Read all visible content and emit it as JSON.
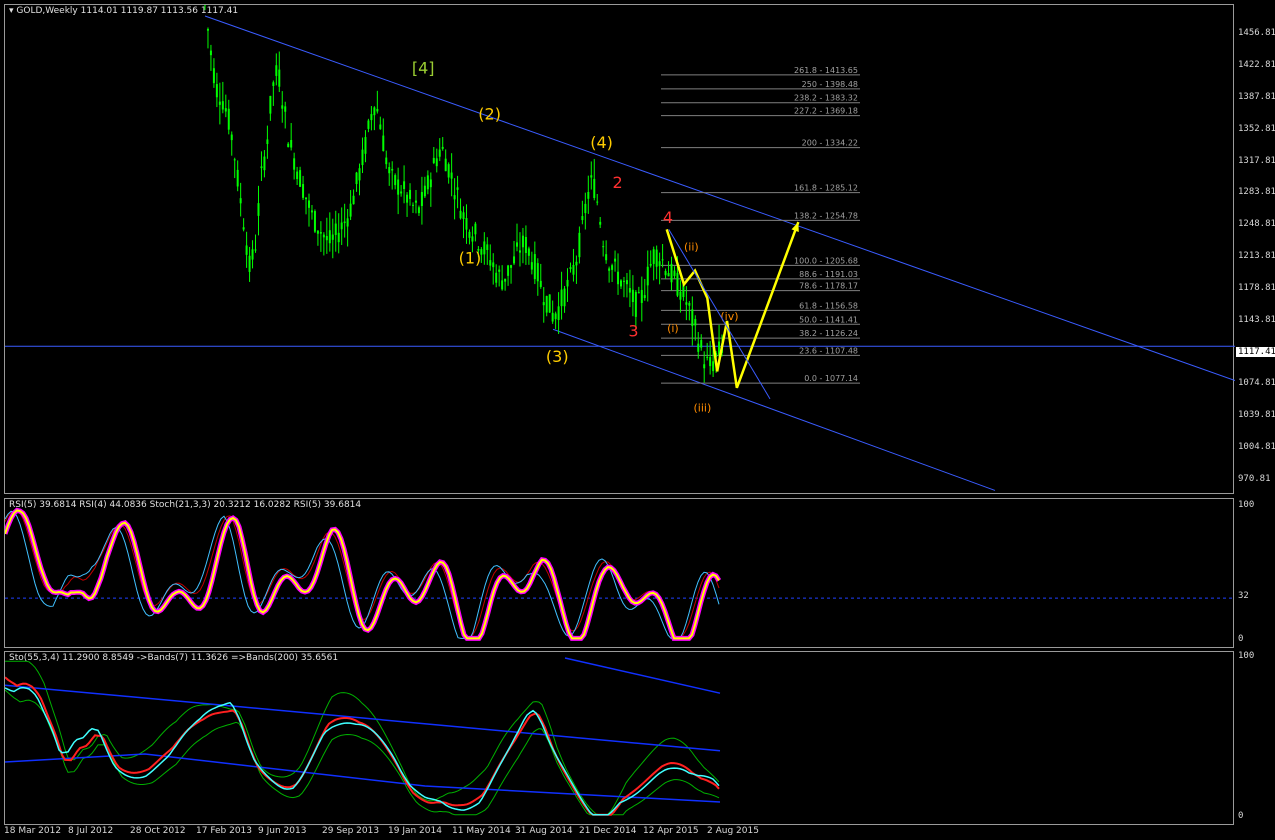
{
  "main_title": "GOLD,Weekly",
  "main_ohlc": "1114.01 1119.87 1113.56 1117.41",
  "rsi_title": "RSI(5) 39.6814  RSI(4) 44.0836  Stoch(21,3,3) 20.3212 16.0282  RSI(5) 39.6814",
  "sto_title": "Sto(55,3,4) 11.2900 8.8549  ->Bands(7) 11.3626  =>Bands(200) 35.6561",
  "current_price": "1117.41",
  "colors": {
    "candle": "#00ff00",
    "channel": "#3a5cff",
    "arrow": "#ffff00",
    "fib": "#808080",
    "wave_label": "#ffcc00",
    "wave_small": "#ff3030",
    "minor_wave": "#ff8c00",
    "rsi_main": "#ffff00",
    "rsi_glow": "#ff00ff"
  },
  "chart_data": [
    {
      "type": "candlestick",
      "title": "GOLD,Weekly",
      "ylim": [
        955,
        1490
      ],
      "yticks": [
        "1456.81",
        "1422.81",
        "1387.81",
        "1352.81",
        "1317.81",
        "1283.81",
        "1248.81",
        "1213.81",
        "1178.81",
        "1143.81",
        "1108.81",
        "1074.81",
        "1039.81",
        "1004.81",
        "970.81"
      ],
      "ytick_values": [
        1456.81,
        1422.81,
        1387.81,
        1352.81,
        1317.81,
        1283.81,
        1248.81,
        1213.81,
        1178.81,
        1143.81,
        1108.81,
        1074.81,
        1039.81,
        1004.81,
        970.81
      ],
      "x_labels": [
        "18 Mar 2012",
        "8 Jul 2012",
        "28 Oct 2012",
        "17 Feb 2013",
        "9 Jun 2013",
        "29 Sep 2013",
        "19 Jan 2014",
        "11 May 2014",
        "31 Aug 2014",
        "21 Dec 2014",
        "12 Apr 2015",
        "2 Aug 2015"
      ],
      "price_path": [
        1490,
        1440,
        1400,
        1390,
        1370,
        1340,
        1290,
        1250,
        1200,
        1230,
        1300,
        1340,
        1400,
        1420,
        1380,
        1340,
        1320,
        1300,
        1280,
        1260,
        1250,
        1240,
        1230,
        1235,
        1245,
        1255,
        1270,
        1295,
        1320,
        1350,
        1385,
        1370,
        1330,
        1300,
        1295,
        1290,
        1280,
        1270,
        1265,
        1280,
        1300,
        1320,
        1335,
        1320,
        1300,
        1280,
        1260,
        1250,
        1240,
        1230,
        1220,
        1210,
        1195,
        1190,
        1200,
        1210,
        1225,
        1230,
        1215,
        1200,
        1180,
        1165,
        1150,
        1160,
        1175,
        1190,
        1210,
        1240,
        1280,
        1300,
        1270,
        1230,
        1210,
        1200,
        1190,
        1180,
        1170,
        1160,
        1175,
        1200,
        1220,
        1215,
        1205,
        1195,
        1185,
        1175,
        1160,
        1140,
        1120,
        1100,
        1095,
        1105,
        1117
      ],
      "fib_levels": [
        {
          "label": "261.8 - 1413.65",
          "value": 1413.65
        },
        {
          "label": "250 - 1398.48",
          "value": 1398.48
        },
        {
          "label": "238.2 - 1383.32",
          "value": 1383.32
        },
        {
          "label": "227.2 - 1369.18",
          "value": 1369.18
        },
        {
          "label": "200 - 1334.22",
          "value": 1334.22
        },
        {
          "label": "161.8 - 1285.12",
          "value": 1285.12
        },
        {
          "label": "138.2 - 1254.78",
          "value": 1254.78
        },
        {
          "label": "100.0 - 1205.68",
          "value": 1205.68
        },
        {
          "label": "88.6 - 1191.03",
          "value": 1191.03
        },
        {
          "label": "78.6 - 1178.17",
          "value": 1178.17
        },
        {
          "label": "61.8 - 1156.58",
          "value": 1156.58
        },
        {
          "label": "50.0 - 1141.41",
          "value": 1141.41
        },
        {
          "label": "38.2 - 1126.24",
          "value": 1126.24
        },
        {
          "label": "23.6 - 1107.48",
          "value": 1107.48
        },
        {
          "label": "0.0 - 1077.14",
          "value": 1077.14
        }
      ],
      "wave_labels": [
        {
          "text": "[4]",
          "color": "#9acd32",
          "x_frac": 0.34,
          "value": 1415
        },
        {
          "text": "(2)",
          "color": "#ffcc00",
          "x_frac": 0.394,
          "value": 1365
        },
        {
          "text": "(4)",
          "color": "#ffcc00",
          "x_frac": 0.485,
          "value": 1334
        },
        {
          "text": "(1)",
          "color": "#ffcc00",
          "x_frac": 0.378,
          "value": 1208
        },
        {
          "text": "(3)",
          "color": "#ffcc00",
          "x_frac": 0.449,
          "value": 1100
        },
        {
          "text": "2",
          "color": "#ff3030",
          "x_frac": 0.498,
          "value": 1290
        },
        {
          "text": "4",
          "color": "#ff3030",
          "x_frac": 0.539,
          "value": 1252
        },
        {
          "text": "3",
          "color": "#ff3030",
          "x_frac": 0.511,
          "value": 1128
        },
        {
          "text": "(ii)",
          "color": "#ff8c00",
          "x_frac": 0.558,
          "value": 1222
        },
        {
          "text": "(i)",
          "color": "#ff8c00",
          "x_frac": 0.543,
          "value": 1133
        },
        {
          "text": "(iv)",
          "color": "#ff8c00",
          "x_frac": 0.589,
          "value": 1146
        },
        {
          "text": "(iii)",
          "color": "#ff8c00",
          "x_frac": 0.567,
          "value": 1046
        }
      ],
      "projection_arrow": [
        [
          0.538,
          1245
        ],
        [
          0.552,
          1185
        ],
        [
          0.561,
          1200
        ],
        [
          0.571,
          1170
        ],
        [
          0.579,
          1090
        ],
        [
          0.587,
          1145
        ],
        [
          0.595,
          1072
        ],
        [
          0.645,
          1253
        ]
      ]
    },
    {
      "type": "line",
      "title": "RSI(5) 39.6814  RSI(4) 44.0836  Stoch(21,3,3) 20.3212 16.0282  RSI(5) 39.6814",
      "ylim": [
        0,
        100
      ],
      "yticks": [
        "100",
        "32",
        "0"
      ],
      "ytick_values": [
        100,
        32,
        0
      ],
      "level_line": 32
    },
    {
      "type": "line",
      "title": "Sto(55,3,4) 11.2900 8.8549  ->Bands(7) 11.3626  =>Bands(200) 35.6561",
      "ylim": [
        0,
        100
      ],
      "yticks": [
        "100",
        "0"
      ],
      "ytick_values": [
        100,
        0
      ]
    }
  ]
}
